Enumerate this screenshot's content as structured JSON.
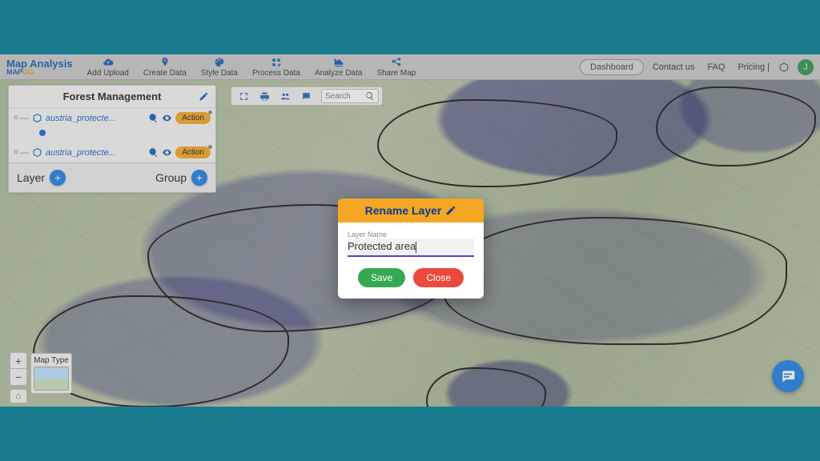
{
  "brand": {
    "title": "Map Analysis",
    "sub_left": "MAP",
    "sub_right": "OG"
  },
  "nav": {
    "add_upload": "Add Upload",
    "create_data": "Create Data",
    "style_data": "Style Data",
    "process_data": "Process Data",
    "analyze_data": "Analyze Data",
    "share_map": "Share Map"
  },
  "topbar_right": {
    "dashboard": "Dashboard",
    "contact": "Contact us",
    "faq": "FAQ",
    "pricing": "Pricing |",
    "avatar_initial": "J"
  },
  "map_toolbar": {
    "search_placeholder": "Search"
  },
  "panel": {
    "title": "Forest Management",
    "layers": [
      {
        "name": "austria_protecte...",
        "action": "Action"
      },
      {
        "name": "austria_protecte...",
        "action": "Action"
      }
    ],
    "layer_label": "Layer",
    "group_label": "Group"
  },
  "maptype_label": "Map Type",
  "modal": {
    "title": "Rename Layer",
    "field_label": "Layer Name",
    "field_value": "Protected area",
    "save": "Save",
    "close": "Close"
  },
  "colors": {
    "accent_blue": "#1b7fe3",
    "accent_orange": "#f5a623",
    "save_green": "#34a853",
    "close_red": "#ea4a3c",
    "overlay_purple": "rgba(100,100,210,0.5)"
  }
}
